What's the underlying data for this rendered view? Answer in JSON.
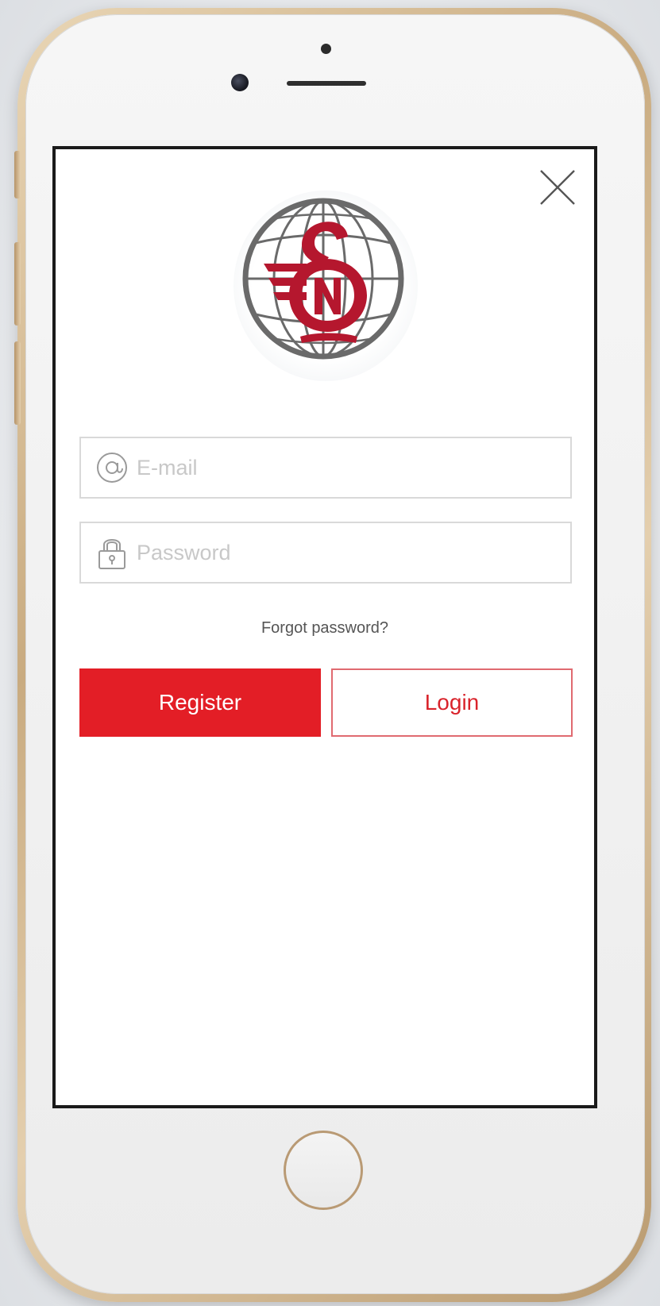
{
  "login": {
    "email": {
      "value": "",
      "placeholder": "E-mail",
      "icon": "at-icon"
    },
    "password": {
      "value": "",
      "placeholder": "Password",
      "icon": "lock-icon"
    },
    "forgot_label": "Forgot password?",
    "register_label": "Register",
    "login_label": "Login"
  },
  "logo": {
    "letters": "SN",
    "icon": "globe-logo-icon"
  },
  "close": {
    "icon": "close-icon"
  },
  "colors": {
    "accent": "#e31e26",
    "logo_red": "#b5172e",
    "logo_gray": "#6a6a6a",
    "placeholder": "#c8c8c8"
  }
}
